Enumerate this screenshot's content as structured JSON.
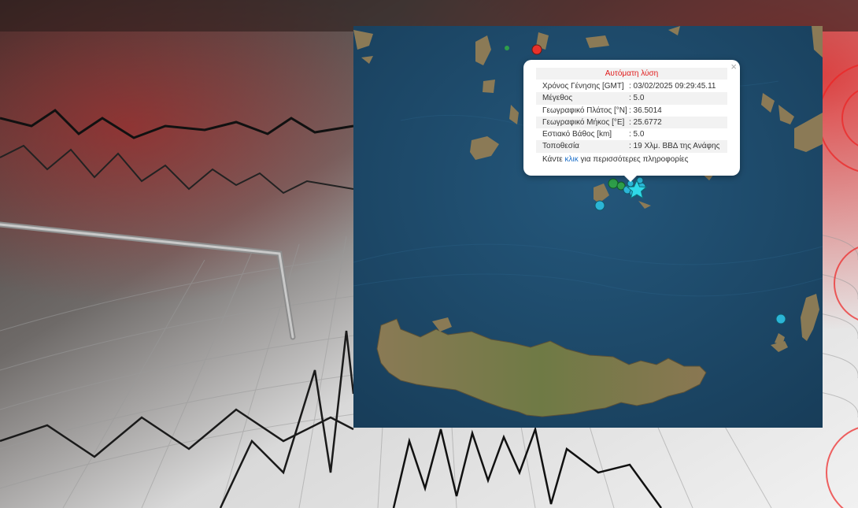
{
  "popup": {
    "title": "Αυτόματη λύση",
    "close": "×",
    "rows": [
      {
        "label": "Χρόνος Γένησης [GMT]",
        "value": ": 03/02/2025 09:29:45.11"
      },
      {
        "label": "Μέγεθος",
        "value": ": 5.0"
      },
      {
        "label": "Γεωγραφικό Πλάτος [°N]",
        "value": ": 36.5014"
      },
      {
        "label": "Γεωγραφικό Μήκος [°E]",
        "value": ": 25.6772"
      },
      {
        "label": "Εστιακό Βάθος [km]",
        "value": ": 5.0"
      },
      {
        "label": "Τοποθεσία",
        "value": ": 19 Χλμ. ΒΒΔ της Ανάφης"
      }
    ],
    "more_prefix": "Κάντε ",
    "more_link": "κλικ",
    "more_suffix": " για περισσότερες πληροφορίες"
  },
  "markers": {
    "colors": {
      "red": "#e8312a",
      "green": "#2e9e4a",
      "cyan": "#2bb5d6",
      "star": "#2fd8e8"
    },
    "epicenter_icon": "star-icon"
  },
  "colors": {
    "sea": "#1e4a6b",
    "land": "#7a6a4a",
    "popup_title": "#e01a1a",
    "link": "#1c6fc9"
  }
}
